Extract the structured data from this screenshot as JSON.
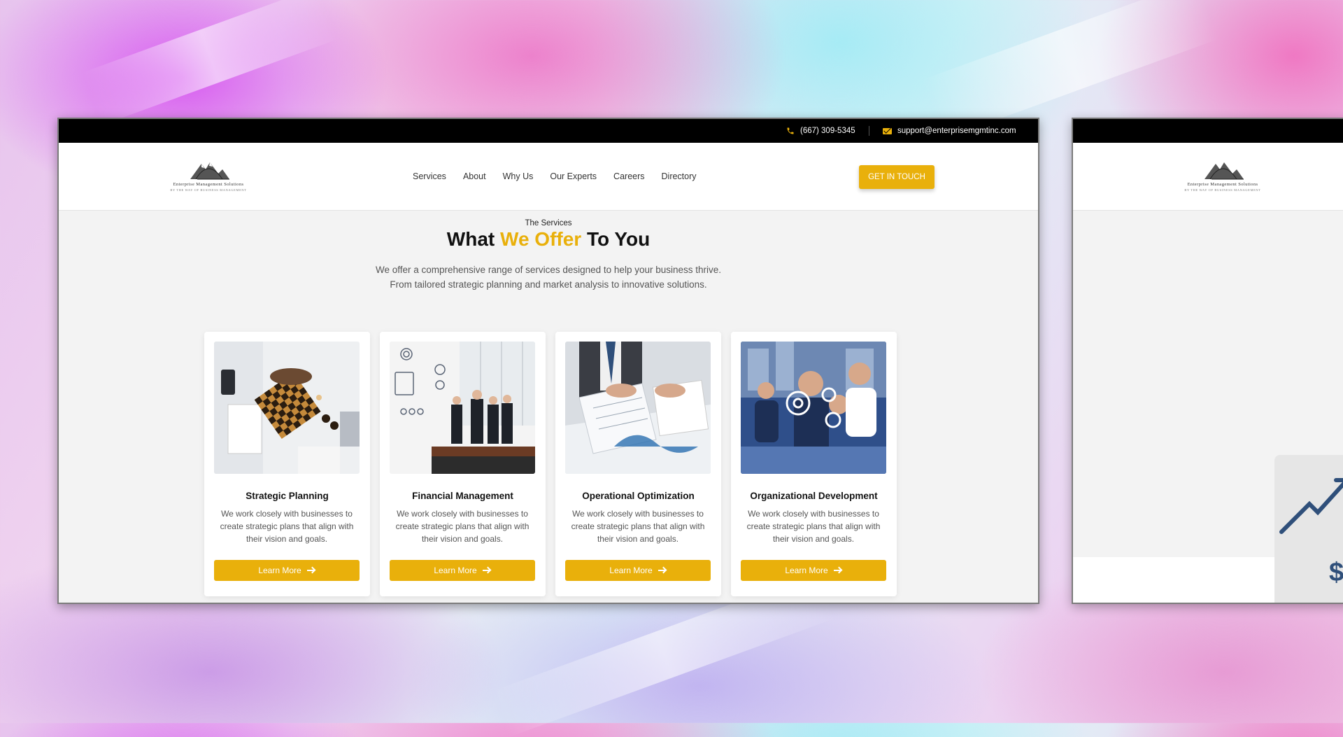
{
  "topbar": {
    "phone": "(667) 309-5345",
    "email": "support@enterprisemgmtinc.com"
  },
  "logo": {
    "name": "Enterprise Management Solutions",
    "tagline": "BY THE WAY OF BUSINESS MANAGEMENT"
  },
  "nav": {
    "items": [
      "Services",
      "About",
      "Why Us",
      "Our Experts",
      "Careers",
      "Directory"
    ],
    "cta": "GET IN TOUCH"
  },
  "section": {
    "eyebrow": "The Services",
    "heading_pre": "What ",
    "heading_highlight": "We Offer",
    "heading_post": " To You",
    "intro_line1": "We offer a comprehensive range of services designed to help your business thrive.",
    "intro_line2": "From tailored strategic planning and market analysis to innovative solutions."
  },
  "cards": [
    {
      "title": "Strategic Planning",
      "desc": "We work closely with businesses to create strategic plans that align with their vision and goals.",
      "button": "Learn More"
    },
    {
      "title": "Financial Management",
      "desc": "We work closely with businesses to create strategic plans that align with their vision and goals.",
      "button": "Learn More"
    },
    {
      "title": "Operational Optimization",
      "desc": "We work closely with businesses to create strategic plans that align with their vision and goals.",
      "button": "Learn More"
    },
    {
      "title": "Organizational Development",
      "desc": "We work closely with businesses to create strategic plans that align with their vision and goals.",
      "button": "Learn More"
    }
  ],
  "colors": {
    "accent": "#e9b00b",
    "topbar": "#000000",
    "page_bg": "#f3f3f3"
  }
}
